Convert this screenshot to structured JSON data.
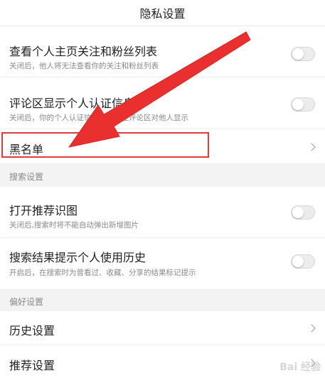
{
  "header": {
    "title": "隐私设置"
  },
  "rows": [
    {
      "label": "查看个人主页关注和粉丝列表",
      "desc": "关闭后，他人将无法查看你的关注和粉丝列表"
    },
    {
      "label": "评论区显示个人认证信息",
      "desc": "关闭后，你的个人认证信息将不会在评论区对他人显示"
    },
    {
      "label": "黑名单"
    }
  ],
  "sections": {
    "search": {
      "title": "搜索设置",
      "rows": [
        {
          "label": "打开推荐识图",
          "desc": "关闭后,搜索时将不能自动弹出新增图片"
        },
        {
          "label": "搜索结果提示个人使用历史",
          "desc": "开启后，在搜索时为曾看过、收藏、分享的结果标记提示"
        }
      ]
    },
    "preference": {
      "title": "偏好设置",
      "rows": [
        {
          "label": "历史设置"
        },
        {
          "label": "推荐设置"
        }
      ]
    }
  },
  "watermark": "Bai 经验",
  "colors": {
    "highlight": "#e33b3b",
    "toggle_off": "#ececec",
    "section_bg": "#f3f3f3"
  },
  "icons": [
    "chevron-right-icon",
    "arrow-annotation"
  ]
}
